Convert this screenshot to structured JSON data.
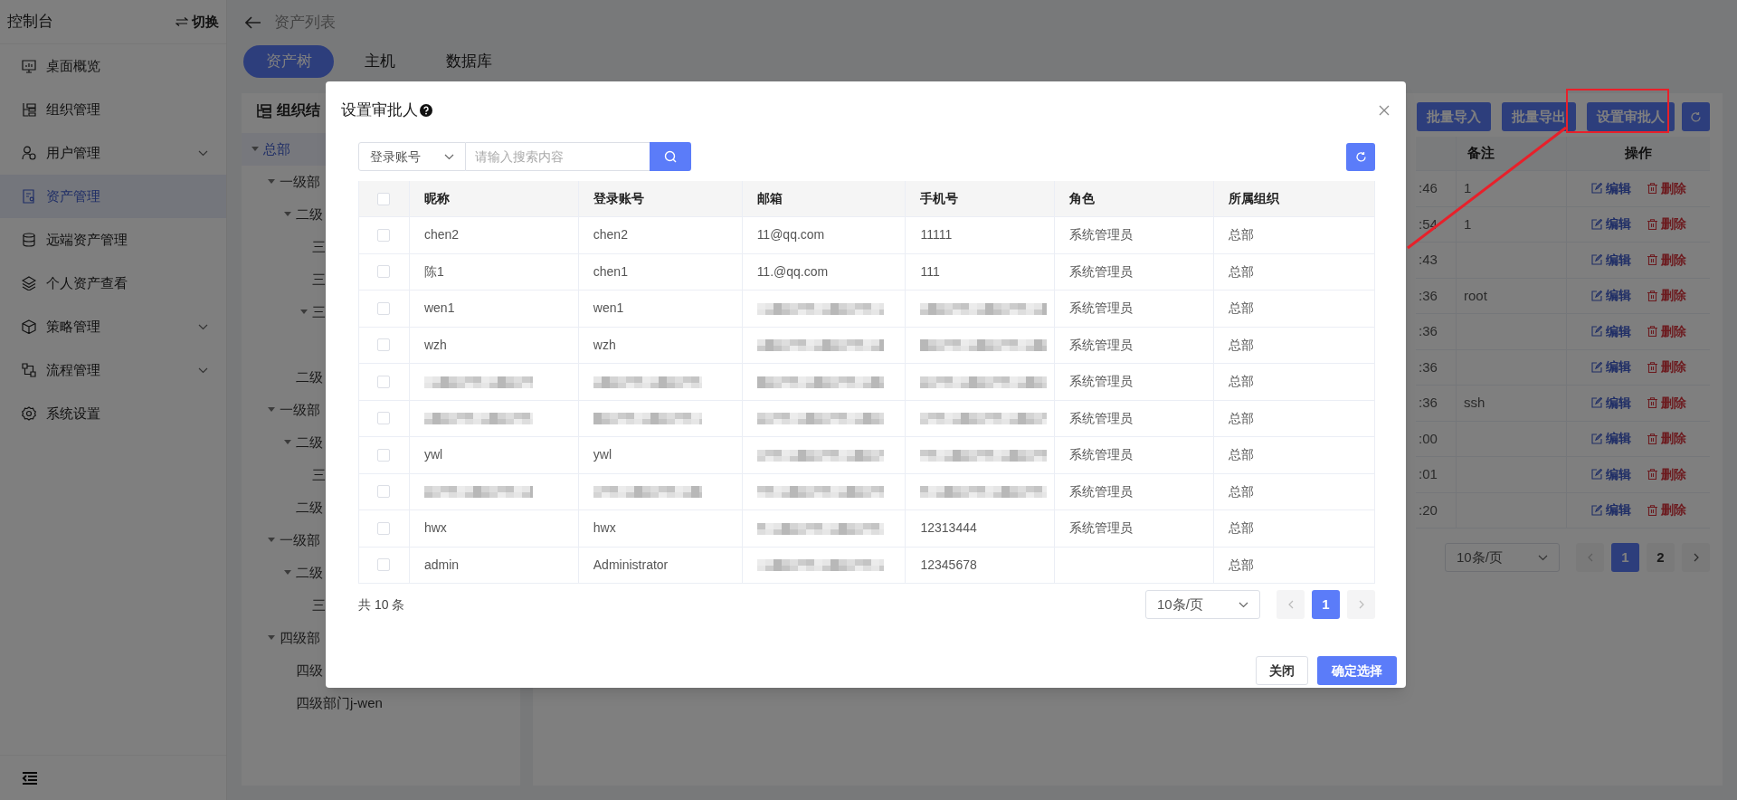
{
  "sidebar": {
    "title": "控制台",
    "switch_label": "切换",
    "items": [
      {
        "label": "桌面概览",
        "selected": false
      },
      {
        "label": "组织管理",
        "selected": false
      },
      {
        "label": "用户管理",
        "selected": false,
        "expanded": false
      },
      {
        "label": "资产管理",
        "selected": true
      },
      {
        "label": "远端资产管理",
        "selected": false
      },
      {
        "label": "个人资产查看",
        "selected": false
      },
      {
        "label": "策略管理",
        "selected": false,
        "expanded": false
      },
      {
        "label": "流程管理",
        "selected": false,
        "expanded": false
      },
      {
        "label": "系统设置",
        "selected": false
      }
    ]
  },
  "page_header": {
    "title": "资产列表"
  },
  "tabs": [
    {
      "label": "资产树",
      "selected": true
    },
    {
      "label": "主机",
      "selected": false
    },
    {
      "label": "数据库",
      "selected": false
    }
  ],
  "tree": {
    "title": "组织结",
    "nodes": [
      {
        "label": "总部",
        "selected": true,
        "expanded": true,
        "children": [
          {
            "label": "一级部",
            "selected": false,
            "expanded": true,
            "children": [
              {
                "label": "二级",
                "selected": false,
                "expanded": true,
                "children": [
                  {
                    "label": "三",
                    "selected": false
                  },
                  {
                    "label": "三",
                    "selected": false
                  },
                  {
                    "label": "三",
                    "selected": false,
                    "expanded": true
                  }
                ]
              },
              {
                "label": "二级",
                "selected": false
              }
            ]
          },
          {
            "label": "一级部",
            "selected": false,
            "expanded": true,
            "children": [
              {
                "label": "二级",
                "selected": false,
                "expanded": true,
                "children": [
                  {
                    "label": "三",
                    "selected": false
                  }
                ]
              },
              {
                "label": "二级",
                "selected": false
              }
            ]
          },
          {
            "label": "一级部",
            "selected": false,
            "expanded": true,
            "children": [
              {
                "label": "二级",
                "selected": false,
                "expanded": true,
                "children": [
                  {
                    "label": "三",
                    "selected": false
                  }
                ]
              }
            ]
          },
          {
            "label": "四级部",
            "selected": false,
            "expanded": true,
            "children": [
              {
                "label": "四级",
                "selected": false
              },
              {
                "label": "四级部门j-wen",
                "selected": false
              }
            ]
          }
        ]
      }
    ]
  },
  "toolbar": {
    "buttons": [
      "批量导入",
      "批量导出",
      "设置审批人"
    ]
  },
  "asset_table": {
    "columns": [
      "备注",
      "操作"
    ],
    "rows": [
      {
        "column_1": ":46",
        "note": "1",
        "actions": [
          "编辑",
          "删除"
        ]
      },
      {
        "column_1": ":54",
        "note": "1",
        "actions": [
          "编辑",
          "删除"
        ]
      },
      {
        "column_1": ":43",
        "actions": [
          "编辑",
          "删除"
        ]
      },
      {
        "column_1": ":36",
        "note": "root",
        "actions": [
          "编辑",
          "删除"
        ]
      },
      {
        "column_1": ":36",
        "actions": [
          "编辑",
          "删除"
        ]
      },
      {
        "column_1": ":36",
        "actions": [
          "编辑",
          "删除"
        ]
      },
      {
        "column_1": ":36",
        "note": "ssh",
        "actions": [
          "编辑",
          "删除"
        ]
      },
      {
        "column_1": ":00",
        "actions": [
          "编辑",
          "删除"
        ]
      },
      {
        "column_1": ":01",
        "actions": [
          "编辑",
          "删除"
        ]
      },
      {
        "column_1": ":20",
        "actions": [
          "编辑",
          "删除"
        ]
      }
    ],
    "pagination": {
      "page_size": "10条/页",
      "pages": [
        {
          "label": "1",
          "selected": true
        },
        {
          "label": "2",
          "selected": false
        }
      ]
    }
  },
  "dialog": {
    "title": "设置审批人",
    "search": {
      "field": "登录账号",
      "placeholder": "请输入搜索内容"
    },
    "select_all_checked": false,
    "columns": [
      "昵称",
      "登录账号",
      "邮箱",
      "手机号",
      "角色",
      "所属组织"
    ],
    "rows": [
      {
        "checked": false,
        "cells": [
          "chen2",
          "chen2",
          "11@qq.com",
          "11111",
          "系统管理员",
          "总部"
        ]
      },
      {
        "checked": false,
        "cells": [
          "陈1",
          "chen1",
          "11.@qq.com",
          "111",
          "系统管理员",
          "总部"
        ]
      },
      {
        "checked": false,
        "cells": [
          "wen1",
          "wen1",
          null,
          null,
          "系统管理员",
          "总部"
        ]
      },
      {
        "checked": false,
        "cells": [
          "wzh",
          "wzh",
          null,
          null,
          "系统管理员",
          "总部"
        ]
      },
      {
        "checked": false,
        "cells": [
          null,
          null,
          null,
          null,
          "系统管理员",
          "总部"
        ]
      },
      {
        "checked": false,
        "cells": [
          null,
          null,
          null,
          null,
          "系统管理员",
          "总部"
        ]
      },
      {
        "checked": false,
        "cells": [
          "ywl",
          "ywl",
          null,
          null,
          "系统管理员",
          "总部"
        ]
      },
      {
        "checked": false,
        "cells": [
          null,
          null,
          null,
          null,
          "系统管理员",
          "总部"
        ]
      },
      {
        "checked": false,
        "cells": [
          "hwx",
          "hwx",
          null,
          "12313444",
          "系统管理员",
          "总部"
        ]
      },
      {
        "checked": false,
        "cells": [
          "admin",
          "Administrator",
          null,
          "12345678",
          "",
          "总部"
        ]
      }
    ],
    "total": "共 10 条",
    "page_size": "10条/页",
    "pages": [
      {
        "label": "1",
        "selected": true
      }
    ],
    "buttons": [
      "关闭",
      "确定选择"
    ]
  }
}
